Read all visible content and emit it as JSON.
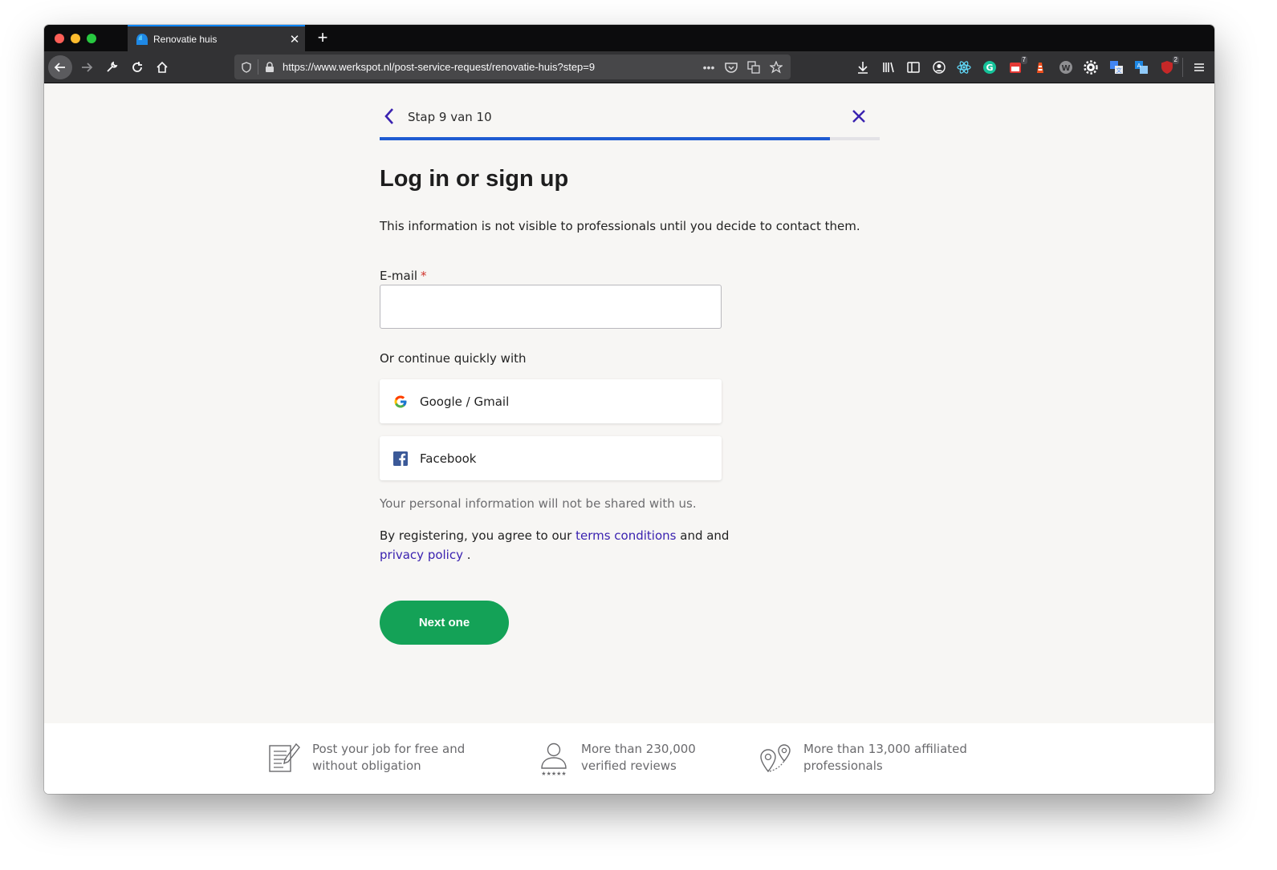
{
  "browser": {
    "tab_title": "Renovatie huis",
    "url": "https://www.werkspot.nl/post-service-request/renovatie-huis?step=9",
    "badges": {
      "ext_calendar": "7",
      "ext_shield": "2"
    }
  },
  "wizard": {
    "step_label": "Stap 9 van 10",
    "progress_fraction": 0.9
  },
  "form": {
    "heading": "Log in or sign up",
    "intro": "This information is not visible to professionals until you decide to contact them.",
    "email_label": "E-mail",
    "required_mark": "*",
    "email_value": "",
    "or_text": "Or continue quickly with",
    "google_label": "Google / Gmail",
    "facebook_label": "Facebook",
    "privacy_note": "Your personal information will not be shared with us.",
    "terms_prefix": "By registering, you agree to our",
    "terms_link": "terms conditions",
    "terms_middle": "and and",
    "privacy_link": "privacy policy",
    "terms_suffix": ".",
    "next_label": "Next one"
  },
  "footer": {
    "features": [
      {
        "icon": "document-edit-icon",
        "text": "Post your job for free and\nwithout obligation"
      },
      {
        "icon": "reviewer-icon",
        "text": "More than 230,000\nverified reviews"
      },
      {
        "icon": "map-pin-icon",
        "text": "More than 13,000 affiliated\nprofessionals"
      }
    ]
  },
  "colors": {
    "accent_blue": "#1f5bd2",
    "link_purple": "#3a22b0",
    "button_green": "#14a257"
  }
}
